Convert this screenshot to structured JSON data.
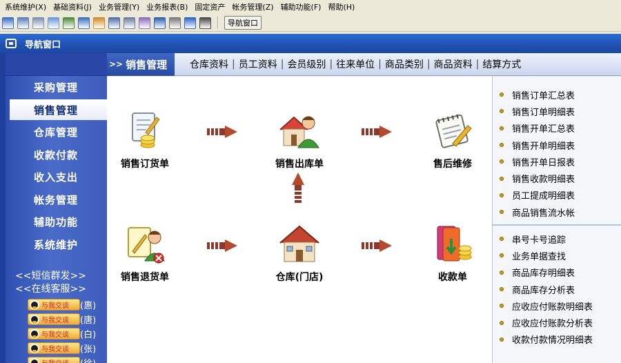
{
  "menu": [
    "系统维护(X)",
    "基础资料(J)",
    "业务管理(Y)",
    "业务报表(B)",
    "固定资产",
    "帐务管理(Z)",
    "辅助功能(F)",
    "帮助(H)"
  ],
  "toolbar": {
    "nav_button": "导航窗口",
    "icon_colors": [
      "#3b6fc6",
      "#5a7fb9",
      "#7c8fb2",
      "#6b9ad8",
      "#4f8b3d",
      "#3a70c0",
      "#d48a2c",
      "#5170a8",
      "#6c7ea0",
      "#8d6fb8",
      "#2f5fb0",
      "#7a7a7a",
      "#2e63c9",
      "#4a4a4a"
    ]
  },
  "nav_window": {
    "title": "导航窗口"
  },
  "sidebar": {
    "items": [
      "采购管理",
      "销售管理",
      "仓库管理",
      "收款付款",
      "收入支出",
      "帐务管理",
      "辅助功能",
      "系统维护"
    ],
    "active_index": 1,
    "sms_link": "<<短信群发>>",
    "service_link": "<<在线客服>>",
    "qq": [
      {
        "badge": "与我交谈",
        "name": "(惠)"
      },
      {
        "badge": "与我交谈",
        "name": "(唐)"
      },
      {
        "badge": "与我交谈",
        "name": "(白)"
      },
      {
        "badge": "与我交谈",
        "name": "(张)"
      },
      {
        "badge": "与我交谈",
        "name": "(徐)"
      }
    ]
  },
  "header": {
    "arrows": ">>",
    "title": "销售管理",
    "links": [
      "仓库资料",
      "员工资料",
      "会员级别",
      "往来单位",
      "商品类别",
      "商品资料",
      "结算方式"
    ],
    "separator": "|"
  },
  "flow": {
    "nodes": [
      {
        "label": "销售订货单",
        "icon": "order-document-icon"
      },
      {
        "label": "销售出库单",
        "icon": "house-person-icon"
      },
      {
        "label": "售后维修",
        "icon": "notepad-pencil-icon"
      },
      {
        "label": "销售退货单",
        "icon": "return-document-icon"
      },
      {
        "label": "仓库(门店)",
        "icon": "warehouse-house-icon"
      },
      {
        "label": "收款单",
        "icon": "payment-binder-icon"
      }
    ]
  },
  "right_panel": {
    "group1": [
      "销售订单汇总表",
      "销售订单明细表",
      "销售开单汇总表",
      "销售开单明细表",
      "销售开单日报表",
      "销售收款明细表",
      "员工提成明细表",
      "商品销售流水帐"
    ],
    "group2": [
      "串号卡号追踪",
      "业务单据查找",
      "商品库存明细表",
      "商品库存分析表",
      "应收应付账款明细表",
      "应收应付账款分析表",
      "收款付款情况明细表"
    ]
  }
}
